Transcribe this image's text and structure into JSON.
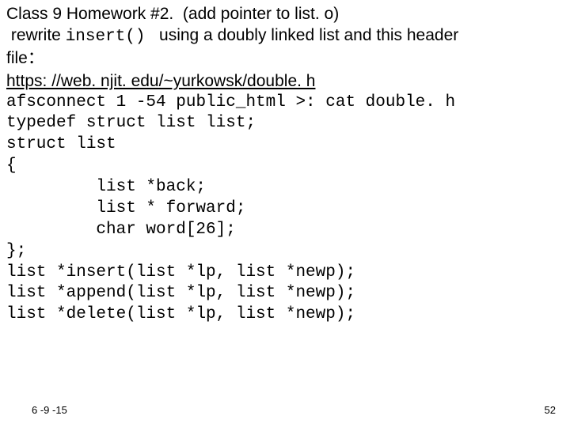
{
  "title_part1": "Class 9 Homework #2.  ",
  "title_part2": "(add pointer to list. o)",
  "line2a": " rewrite ",
  "line2b": "insert()",
  "line2c": "   using a doubly linked list and this header",
  "line3a": "file",
  "line3b": "：",
  "link_text": "https: //web. njit. edu/~yurkowsk/double. h",
  "code": {
    "l1": "afsconnect 1 -54 public_html >: cat double. h",
    "l2": "typedef struct list list;",
    "l3": "struct list",
    "l4": "{",
    "l5": "list *back;",
    "l6": "list * forward;",
    "l7": "char word[26];",
    "l8": "};",
    "l9": "list *insert(list *lp, list *newp);",
    "l10": "list *append(list *lp, list *newp);",
    "l11": "list *delete(list *lp, list *newp);"
  },
  "footer_date": "6 -9 -15",
  "footer_page": "52"
}
